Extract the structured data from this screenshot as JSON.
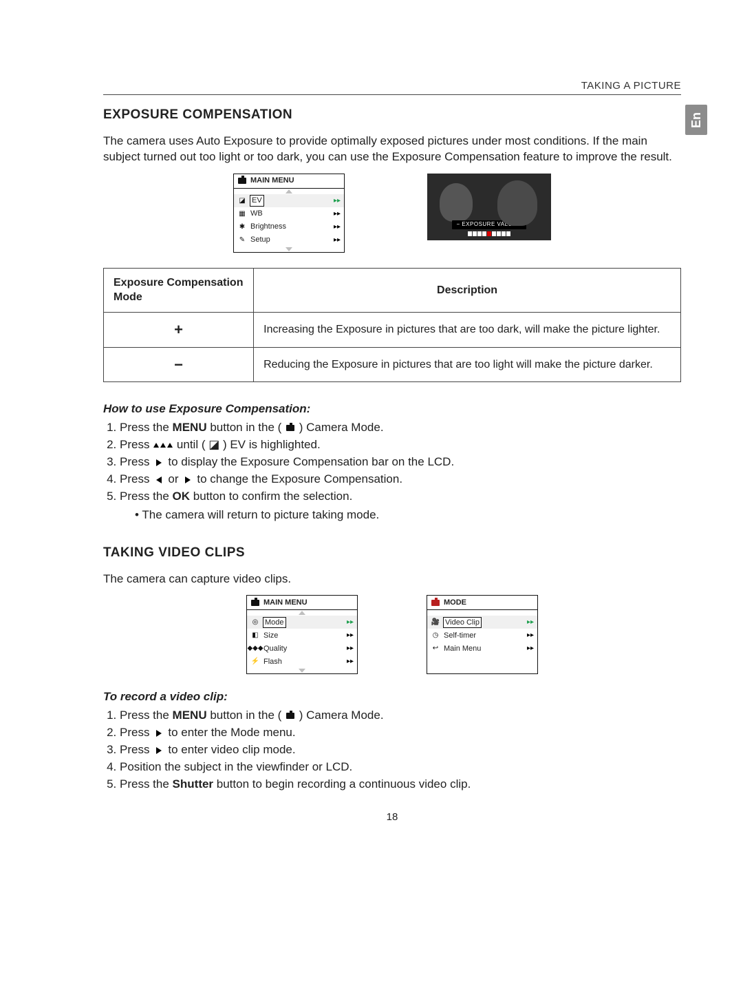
{
  "header": {
    "running_head": "TAKING A PICTURE"
  },
  "lang_tab": "En",
  "section1": {
    "title": "EXPOSURE COMPENSATION",
    "intro": "The camera uses Auto Exposure to provide optimally exposed pictures under most conditions. If the main subject turned out too light or too dark, you can use the Exposure Compensation feature to improve the result.",
    "main_menu": {
      "title": "MAIN MENU",
      "items": [
        {
          "icon": "ev-icon",
          "label": "EV",
          "selected": true
        },
        {
          "icon": "wb-icon",
          "label": "WB",
          "selected": false
        },
        {
          "icon": "star-icon",
          "label": "Brightness",
          "selected": false
        },
        {
          "icon": "wrench-icon",
          "label": "Setup",
          "selected": false
        }
      ]
    },
    "photo_overlay": {
      "label": "−  EXPOSURE VALUE  +"
    },
    "table": {
      "head_mode": "Exposure Compensation Mode",
      "head_desc": "Description",
      "rows": [
        {
          "sym": "+",
          "desc": "Increasing the Exposure in pictures that are too dark, will make the picture lighter."
        },
        {
          "sym": "−",
          "desc": "Reducing the Exposure in pictures that are too light will make the picture darker."
        }
      ]
    },
    "howto_title": "How to use Exposure Compensation:",
    "steps": {
      "s1a": "Press the ",
      "s1b": "MENU",
      "s1c": " button in the ( ",
      "s1d": " ) Camera Mode.",
      "s2a": "Press ",
      "s2b": " until ( ",
      "s2c": " ) EV is highlighted.",
      "s3a": "Press ",
      "s3b": " to display the Exposure Compensation bar on the LCD.",
      "s4a": "Press ",
      "s4b": " or ",
      "s4c": " to change the Exposure Compensation.",
      "s5a": "Press the ",
      "s5b": "OK",
      "s5c": " button to confirm the selection.",
      "s5_bullet": "• The camera will return to picture taking mode."
    }
  },
  "section2": {
    "title": "TAKING VIDEO CLIPS",
    "intro": "The camera can capture video clips.",
    "main_menu": {
      "title": "MAIN MENU",
      "items": [
        {
          "icon": "mode-icon",
          "label": "Mode",
          "selected": true
        },
        {
          "icon": "size-icon",
          "label": "Size",
          "selected": false
        },
        {
          "icon": "quality-icon",
          "label": "Quality",
          "selected": false
        },
        {
          "icon": "flash-icon",
          "label": "Flash",
          "selected": false
        }
      ]
    },
    "mode_menu": {
      "title": "MODE",
      "items": [
        {
          "icon": "video-icon",
          "label": "Video Clip",
          "selected": true
        },
        {
          "icon": "timer-icon",
          "label": "Self-timer",
          "selected": false
        },
        {
          "icon": "back-icon",
          "label": "Main Menu",
          "selected": false
        }
      ]
    },
    "howto_title": "To record a video clip:",
    "steps": {
      "s1a": "Press the ",
      "s1b": "MENU",
      "s1c": " button in the ( ",
      "s1d": " ) Camera Mode.",
      "s2a": "Press ",
      "s2b": " to enter the Mode menu.",
      "s3a": "Press ",
      "s3b": " to enter video clip mode.",
      "s4": "Position the subject in the viewfinder or LCD.",
      "s5a": "Press the ",
      "s5b": "Shutter",
      "s5c": " button to begin recording a continuous video clip."
    }
  },
  "page_number": "18"
}
